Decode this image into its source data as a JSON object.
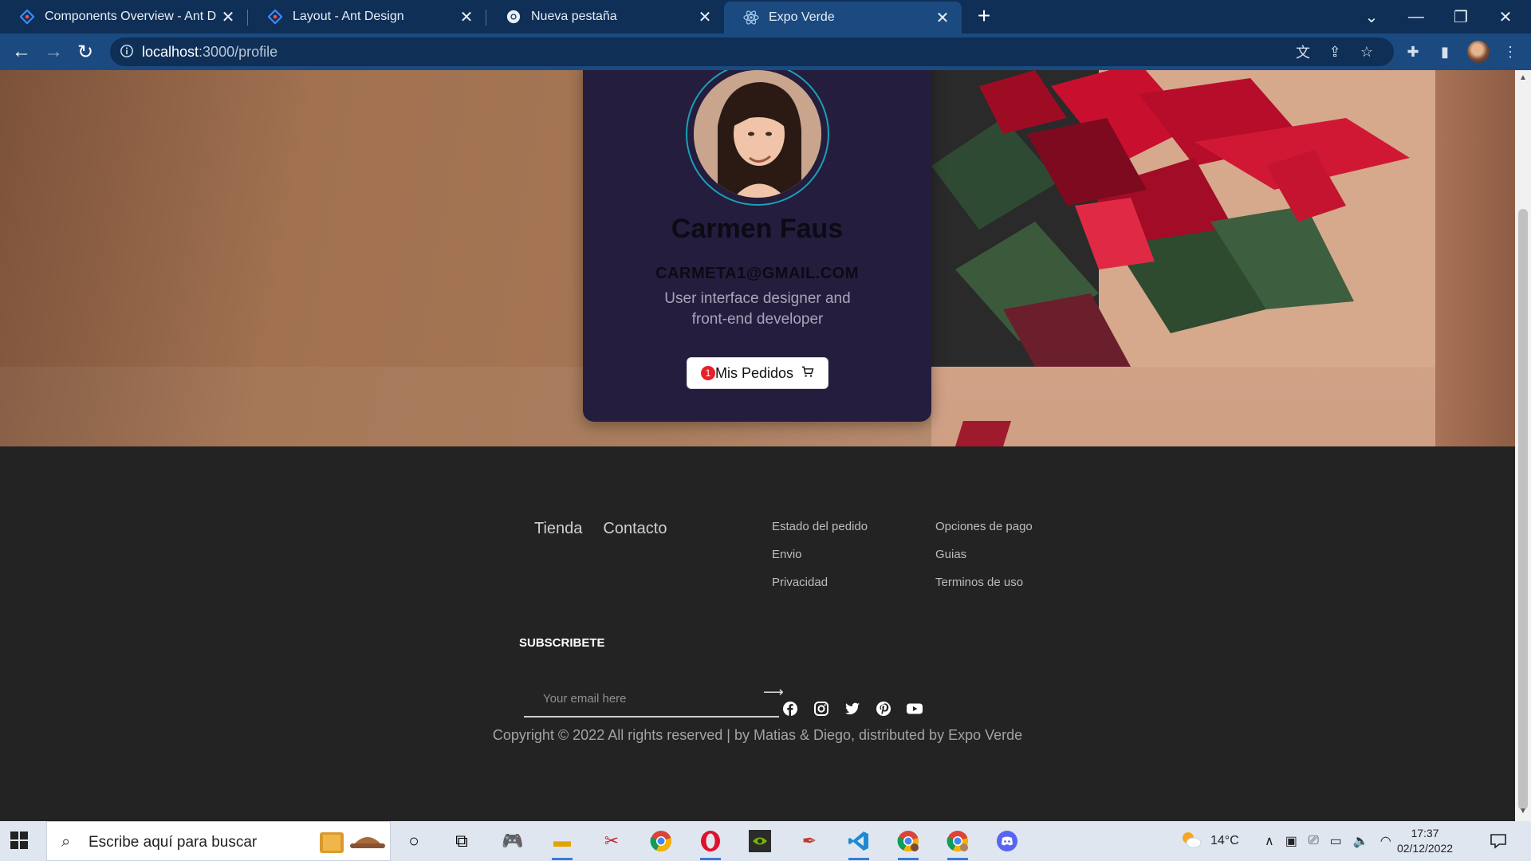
{
  "browser": {
    "tabs": [
      {
        "title": "Components Overview - Ant Des",
        "icon": "ant-design-icon",
        "active": false
      },
      {
        "title": "Layout - Ant Design",
        "icon": "ant-design-icon",
        "active": false
      },
      {
        "title": "Nueva pestaña",
        "icon": "chrome-icon",
        "active": false
      },
      {
        "title": "Expo Verde",
        "icon": "react-icon",
        "active": true
      }
    ],
    "url_host": "localhost",
    "url_path": ":3000/profile",
    "colors": {
      "tabbar": "#0f2f57",
      "toolbar": "#1b4a80"
    }
  },
  "profile": {
    "name": "Carmen Faus",
    "email": "CARMETA1@GMAIL.COM",
    "bio": "User interface designer and front-end developer",
    "orders_label": "Mis Pedidos",
    "orders_badge": "1",
    "card_color": "#241d3d",
    "ring_color": "#1aa0b6"
  },
  "footer": {
    "nav": [
      "Tienda",
      "Contacto"
    ],
    "col1": [
      "Estado del pedido",
      "Envio",
      "Privacidad"
    ],
    "col2": [
      "Opciones de pago",
      "Guias",
      "Terminos de uso"
    ],
    "subscribe_title": "SUBSCRIBETE",
    "email_placeholder": "Your email here",
    "socials": [
      "facebook-icon",
      "instagram-icon",
      "twitter-icon",
      "pinterest-icon",
      "youtube-icon"
    ],
    "copyright": "Copyright © 2022 All rights reserved | by Matias & Diego, distributed by Expo Verde"
  },
  "taskbar": {
    "search_placeholder": "Escribe aquí para buscar",
    "weather": "14°C",
    "time": "17:37",
    "date": "02/12/2022"
  }
}
